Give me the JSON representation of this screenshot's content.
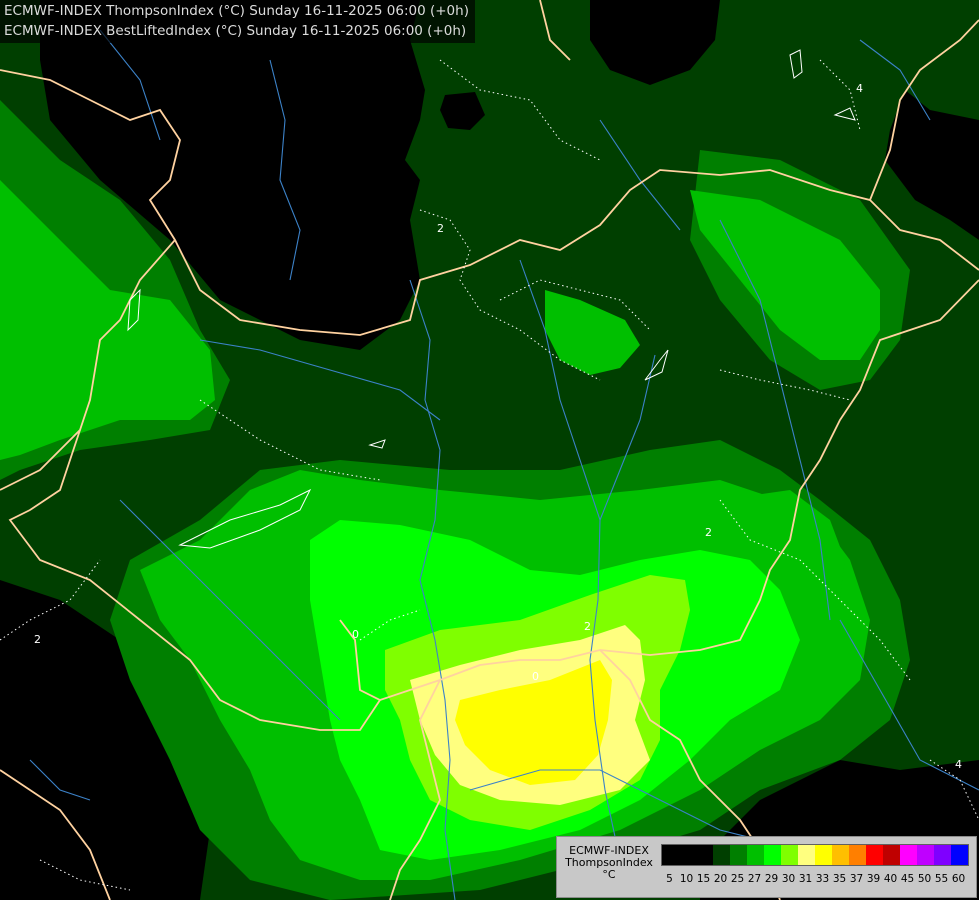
{
  "header": {
    "line1": "ECMWF-INDEX ThompsonIndex (°C) Sunday 16-11-2025 06:00 (+0h)",
    "line2": "ECMWF-INDEX BestLiftedIndex (°C) Sunday 16-11-2025 06:00 (+0h)"
  },
  "legend": {
    "title_lines": [
      "ECMWF-INDEX",
      "ThompsonIndex",
      "°C"
    ],
    "labels": [
      "5",
      "10",
      "15",
      "20",
      "25",
      "27",
      "29",
      "30",
      "31",
      "33",
      "35",
      "37",
      "39",
      "40",
      "45",
      "50",
      "55",
      "60"
    ],
    "colors": [
      "#000000",
      "#000000",
      "#000000",
      "#003f00",
      "#007f00",
      "#00bf00",
      "#00ff00",
      "#7fff00",
      "#ffff7f",
      "#ffff00",
      "#ffbf00",
      "#ff7f00",
      "#ff0000",
      "#bf0000",
      "#ff00ff",
      "#bf00ff",
      "#7f00ff",
      "#0000ff"
    ]
  },
  "contours": {
    "lifted_index_labels": [
      "2",
      "2",
      "2",
      "2",
      "0",
      "0",
      "4",
      "4"
    ]
  },
  "colors": {
    "fill_dark": "#003f00",
    "fill_mid": "#007f00",
    "fill_med": "#00bf00",
    "fill_bright": "#00ff00",
    "fill_lime": "#7fff00",
    "fill_pale_yellow": "#ffff7f",
    "fill_yellow": "#ffff00",
    "border": "#ffd2a0",
    "river": "#3c82c8"
  }
}
